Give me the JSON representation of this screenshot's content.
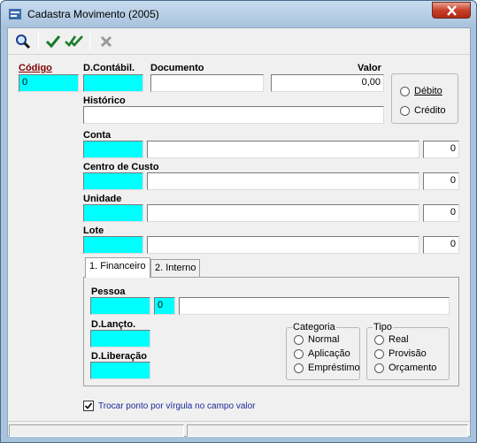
{
  "window": {
    "title": "Cadastra Movimento (2005)"
  },
  "toolbar": {
    "search_icon": "magnifier-icon",
    "check_icon": "check-icon",
    "double_check_icon": "double-check-icon",
    "cancel_icon": "x-icon"
  },
  "form": {
    "codigo": {
      "label": "Código",
      "value": "0"
    },
    "d_contabil": {
      "label": "D.Contábil.",
      "value": ""
    },
    "documento": {
      "label": "Documento",
      "value": ""
    },
    "valor": {
      "label": "Valor",
      "value": "0,00"
    },
    "debito_label": "Débito",
    "credito_label": "Crédito",
    "historico": {
      "label": "Histórico",
      "value": ""
    },
    "conta": {
      "label": "Conta",
      "code": "",
      "desc": "",
      "num": "0"
    },
    "centro_custo": {
      "label": "Centro de Custo",
      "code": "",
      "desc": "",
      "num": "0"
    },
    "unidade": {
      "label": "Unidade",
      "code": "",
      "desc": "",
      "num": "0"
    },
    "lote": {
      "label": "Lote",
      "code": "",
      "desc": "",
      "num": "0"
    }
  },
  "tabs": [
    {
      "label": "1. Financeiro"
    },
    {
      "label": "2. Interno"
    }
  ],
  "financeiro": {
    "pessoa": {
      "label": "Pessoa",
      "code": "",
      "small": "0",
      "desc": ""
    },
    "d_lancto": {
      "label": "D.Lançto.",
      "value": ""
    },
    "d_liberacao": {
      "label": "D.Liberação",
      "value": ""
    },
    "categoria": {
      "title": "Categoria",
      "options": [
        "Normal",
        "Aplicação",
        "Empréstimo"
      ]
    },
    "tipo": {
      "title": "Tipo",
      "options": [
        "Real",
        "Provisão",
        "Orçamento"
      ]
    }
  },
  "checkbox": {
    "label": "Trocar ponto por vírgula no campo valor",
    "checked": true
  }
}
